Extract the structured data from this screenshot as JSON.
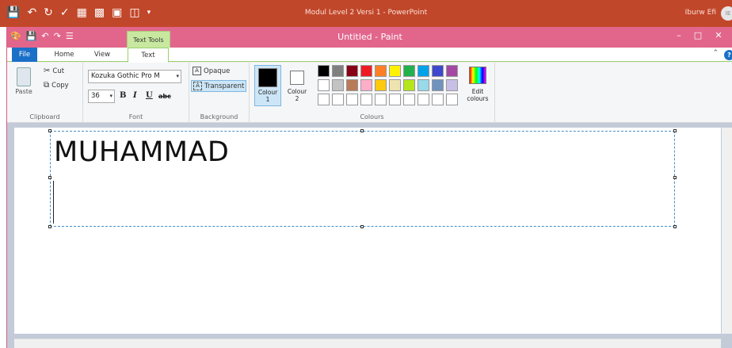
{
  "ppt": {
    "title": "Modul Level 2 Versi 1  -  PowerPoint",
    "user": "Iburw Efi",
    "avatar_initials": "IE",
    "qa_icons": [
      "save-icon",
      "undo-icon",
      "redo-icon",
      "spelling-icon",
      "picture-icon",
      "format-icon",
      "slideshow-icon",
      "preview-icon",
      "dropdown-icon"
    ]
  },
  "paint": {
    "title": "Untitled - Paint",
    "context_tab": "Text Tools",
    "tabs": [
      "File",
      "Home",
      "View",
      "Text"
    ],
    "active_tab": "Text"
  },
  "ribbon": {
    "clipboard": {
      "label": "Clipboard",
      "paste": "Paste",
      "cut": "Cut",
      "copy": "Copy"
    },
    "font": {
      "label": "Font",
      "family": "Kozuka Gothic Pro M",
      "size": "36",
      "bold": "B",
      "italic": "I",
      "underline": "U",
      "strike": "abc"
    },
    "background": {
      "label": "Background",
      "opaque": "Opaque",
      "transparent": "Transparent",
      "selected": "Transparent"
    },
    "colours": {
      "label": "Colours",
      "colour1": "Colour 1",
      "colour2": "Colour 2",
      "edit": "Edit colours",
      "colour1_value": "#000000",
      "colour2_value": "#ffffff",
      "palette_row1": [
        "#000000",
        "#7f7f7f",
        "#880015",
        "#ed1c24",
        "#ff7f27",
        "#fff200",
        "#22b14c",
        "#00a2e8",
        "#3f48cc",
        "#a349a4"
      ],
      "palette_row2": [
        "#ffffff",
        "#c3c3c3",
        "#b97a57",
        "#ffaec9",
        "#ffc90e",
        "#efe4b0",
        "#b5e61d",
        "#99d9ea",
        "#7092be",
        "#c8bfe7"
      ],
      "palette_row3": [
        "#ffffff",
        "#ffffff",
        "#ffffff",
        "#ffffff",
        "#ffffff",
        "#ffffff",
        "#ffffff",
        "#ffffff",
        "#ffffff",
        "#ffffff"
      ]
    }
  },
  "canvas": {
    "text": "MUHAMMAD"
  }
}
